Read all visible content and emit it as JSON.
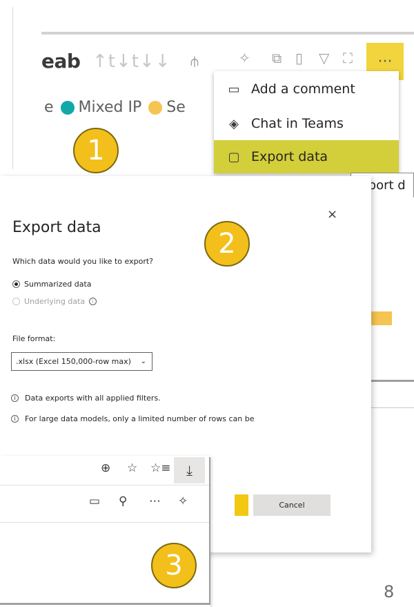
{
  "visual": {
    "title_fragment": "eab",
    "sort_icons": "↑t↓t↓↓",
    "more_label": "···",
    "legend": [
      {
        "label": "e",
        "color": ""
      },
      {
        "label": "Mixed IP",
        "color": "#13a8a8"
      },
      {
        "label": "Se",
        "color": "#f5c451"
      }
    ]
  },
  "context_menu": {
    "items": [
      {
        "label": "Add a comment",
        "icon": "comment-icon"
      },
      {
        "label": "Chat in Teams",
        "icon": "teams-icon"
      },
      {
        "label": "Export data",
        "icon": "export-icon"
      }
    ],
    "tooltip_fragment": "xport d"
  },
  "badges": {
    "one": "1",
    "two": "2",
    "three": "3"
  },
  "dialog": {
    "title": "Export data",
    "close": "×",
    "question": "Which data would you like to export?",
    "options": [
      {
        "label": "Summarized data",
        "selected": true,
        "disabled": false
      },
      {
        "label": "Underlying data",
        "selected": false,
        "disabled": true
      }
    ],
    "file_format_label": "File format:",
    "file_format_value": ".xlsx (Excel 150,000-row max)",
    "notes": [
      "Data exports with all applied filters.",
      "For large data models, only a limited number of rows can be"
    ],
    "cancel_label": "Cancel"
  },
  "colors": {
    "accent": "#f2c811",
    "badge": "#f3bf1a",
    "teal": "#13a8a8"
  },
  "page_number": "8"
}
